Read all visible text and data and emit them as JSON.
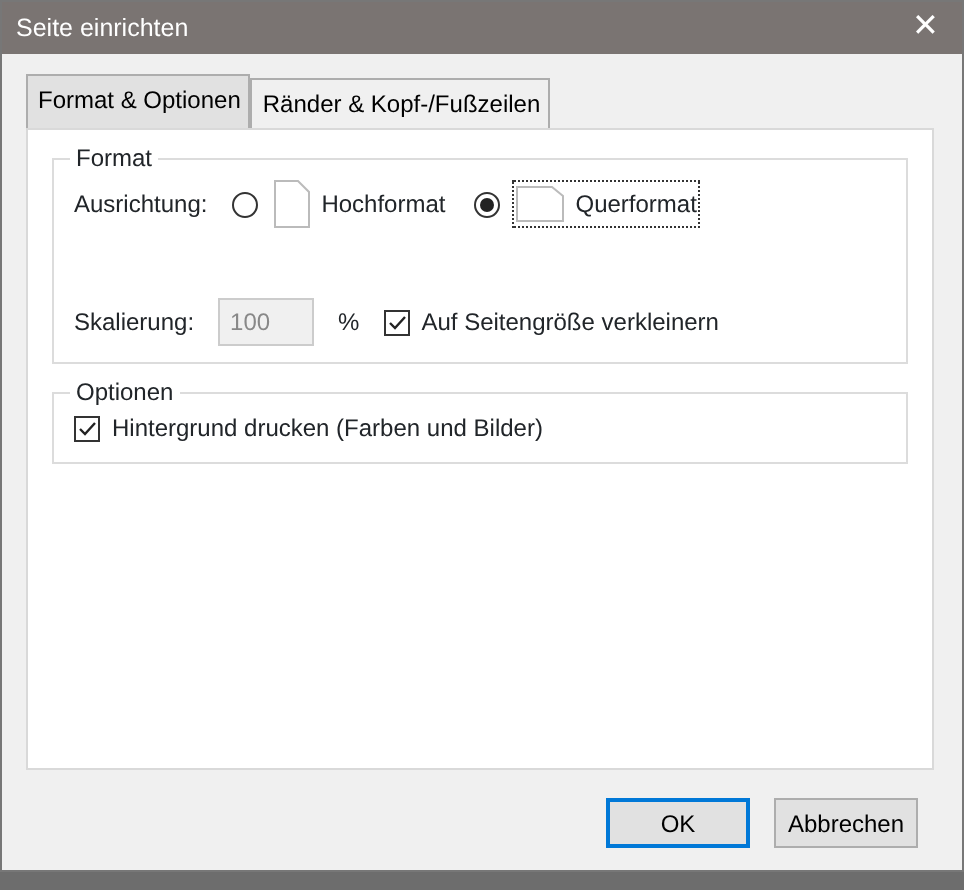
{
  "window": {
    "title": "Seite einrichten",
    "close": "✕"
  },
  "tabs": [
    {
      "label": "Format & Optionen",
      "selected": true
    },
    {
      "label": "Ränder & Kopf-/Fußzeilen",
      "selected": false
    }
  ],
  "format_group": {
    "title": "Format",
    "orientation_label": "Ausrichtung:",
    "orientations": [
      {
        "label": "Hochformat",
        "kind": "portrait",
        "selected": false,
        "focused": false
      },
      {
        "label": "Querformat",
        "kind": "landscape",
        "selected": true,
        "focused": true
      }
    ],
    "scale_label": "Skalierung:",
    "scale_value": "100",
    "scale_disabled": true,
    "percent": "%",
    "shrink": {
      "label": "Auf Seitengröße verkleinern",
      "checked": true
    }
  },
  "options_group": {
    "title": "Optionen",
    "items": [
      {
        "label": "Hintergrund drucken (Farben und Bilder)",
        "checked": true
      }
    ]
  },
  "buttons": [
    {
      "label": "OK",
      "default": true
    },
    {
      "label": "Abbrechen",
      "default": false
    }
  ]
}
